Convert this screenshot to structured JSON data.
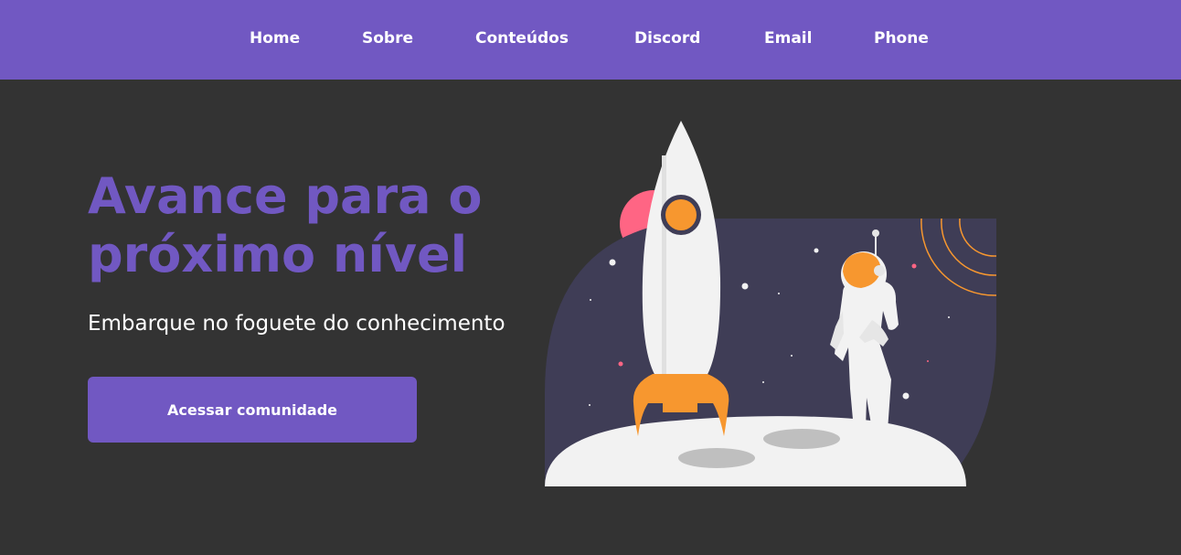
{
  "nav": {
    "items": [
      {
        "label": "Home"
      },
      {
        "label": "Sobre"
      },
      {
        "label": "Conteúdos"
      },
      {
        "label": "Discord"
      },
      {
        "label": "Email"
      },
      {
        "label": "Phone"
      }
    ]
  },
  "hero": {
    "title": "Avance para o próximo nível",
    "subtitle": "Embarque no foguete do conhecimento",
    "cta_label": "Acessar comunidade"
  },
  "illustration": {
    "icon": "rocket-astronaut-illustration"
  },
  "colors": {
    "brand": "#7158c2",
    "background": "#333333",
    "text": "#ffffff",
    "space": "#3f3d56",
    "orange": "#f7972f",
    "pink": "#ff6584",
    "moon": "#f2f2f2"
  }
}
